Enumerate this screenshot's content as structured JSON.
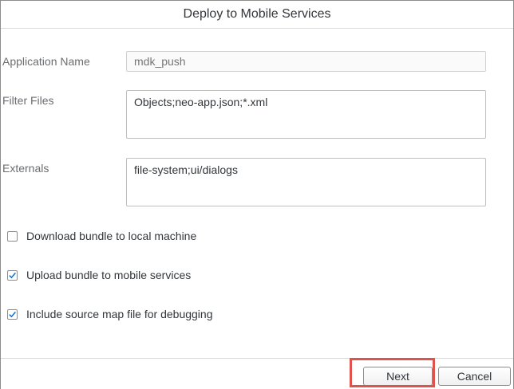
{
  "dialog": {
    "title": "Deploy to Mobile Services"
  },
  "form": {
    "application_name": {
      "label": "Application Name",
      "placeholder": "mdk_push"
    },
    "filter_files": {
      "label": "Filter Files",
      "value": "Objects;neo-app.json;*.xml"
    },
    "externals": {
      "label": "Externals",
      "value": "file-system;ui/dialogs"
    }
  },
  "options": [
    {
      "label": "Download bundle to local machine",
      "checked": false
    },
    {
      "label": "Upload bundle to mobile services",
      "checked": true
    },
    {
      "label": "Include source map file for debugging",
      "checked": true
    }
  ],
  "footer": {
    "next_label": "Next",
    "cancel_label": "Cancel"
  },
  "colors": {
    "highlight": "#e0534d",
    "check": "#0a6ed1"
  }
}
